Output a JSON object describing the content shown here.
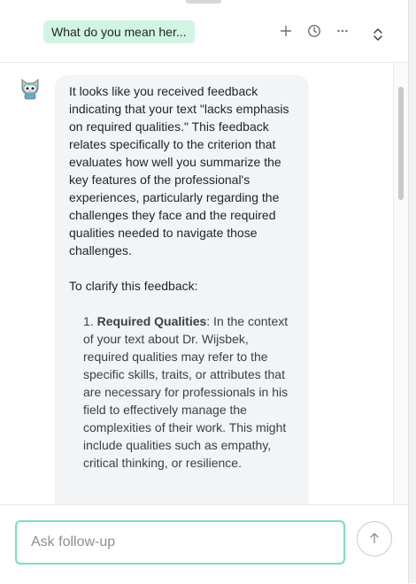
{
  "header": {
    "title": "What do you mean her..."
  },
  "icons": {
    "new": "plus-icon",
    "history": "clock-icon",
    "more": "more-icon",
    "expand": "expand-collapse-icon",
    "avatar": "bot-avatar-icon",
    "send": "arrow-up-icon"
  },
  "message": {
    "intro": "It looks like you received feedback indicating that your text \"lacks emphasis on required qualities.\" This feedback relates specifically to the criterion that evaluates how well you summarize the key features of the professional's experiences, particularly regarding the challenges they face and the required qualities needed to navigate those challenges.",
    "clarify": "To clarify this feedback:",
    "items": [
      {
        "number": "1.",
        "heading": "Required Qualities",
        "text": ": In the context of your text about Dr. Wijsbek, required qualities may refer to the specific skills, traits, or attributes that are necessary for professionals in his field to effectively manage the complexities of their work. This might include qualities such as empathy, critical thinking, or resilience."
      }
    ]
  },
  "composer": {
    "placeholder": "Ask follow-up",
    "value": ""
  },
  "colors": {
    "chip_bg": "#d1f5e2",
    "input_border": "#7be0b4",
    "bubble_bg": "#f3f4f5"
  }
}
